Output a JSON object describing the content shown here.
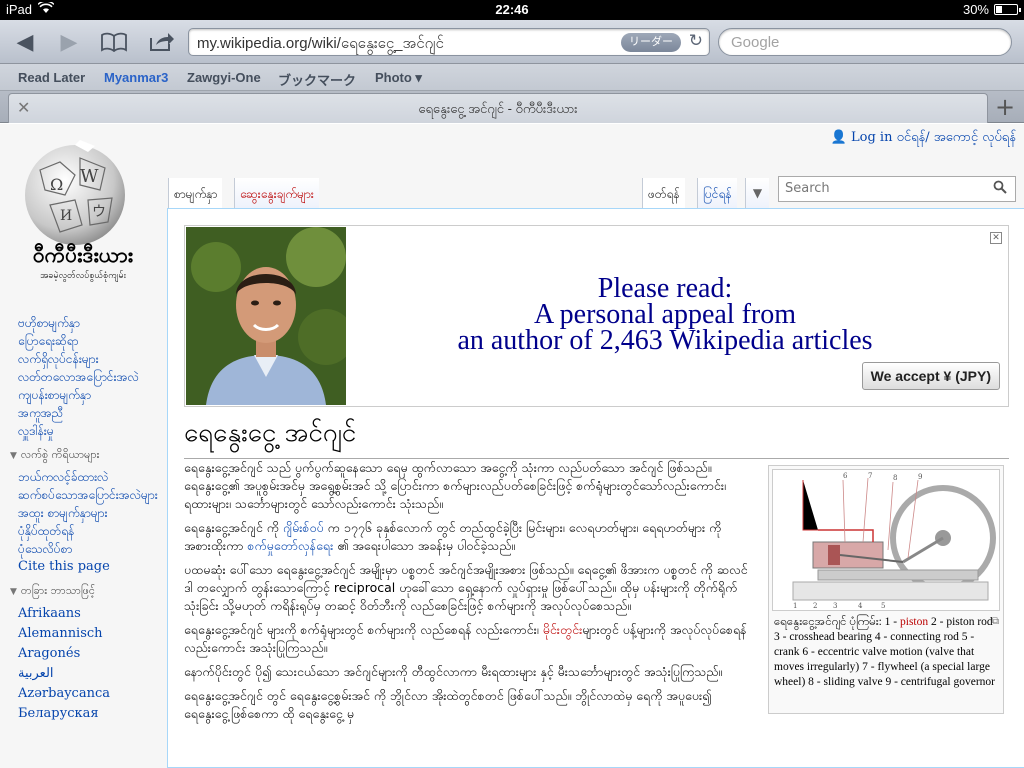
{
  "status": {
    "device": "iPad",
    "time": "22:46",
    "battery": "30%",
    "battery_level": 0.3
  },
  "toolbar": {
    "url": "my.wikipedia.org/wiki/ရေနွေးငွေ့_အင်ဂျင်",
    "reader_label": "リーダー",
    "search_placeholder": "Google"
  },
  "bookmarks": [
    "Read Later",
    "Myanmar3",
    "Zawgyi-One",
    "ブックマーク",
    "Photo ▾"
  ],
  "tab": {
    "title": "ရေနွေးငွေ့ အင်ဂျင် - ဝီကီပီးဒီးယား"
  },
  "wiki": {
    "login": "Log in ဝင်ရန်/ အကောင့် လုပ်ရန်",
    "logo_name": "ဝီကီပီးဒီးယား",
    "logo_tagline": "အခမဲ့လွတ်လပ်စွယ်စုံကျမ်း",
    "nav": [
      "ဗဟိုစာမျက်နှာ",
      "ပြောရေးဆိုရာ",
      "လက်ရှိလုပ်ငန်းများ",
      "လတ်တလောအပြောင်းအလဲ",
      "ကျပန်းစာမျက်နှာ",
      "အကူအညီ",
      "လှူဒါန်းမှု"
    ],
    "toolbox_heading": "လက်စွဲ ကိရိယာများ",
    "toolbox": [
      "ဘယ်ကလင့်ခ်ထားလဲ",
      "ဆက်စပ်သောအပြောင်းအလဲများ",
      "အထူး စာမျက်နှာများ",
      "ပုံနှိပ်ထုတ်ရန်",
      "ပုံသေလိပ်စာ",
      "Cite this page"
    ],
    "languages_heading": "တခြား ဘာသာဖြင့်",
    "languages": [
      "Afrikaans",
      "Alemannisch",
      "Aragonés",
      "العربية",
      "Azərbaycanca",
      "Беларуская"
    ],
    "tabs": {
      "page": "စာမျက်နှာ",
      "talk": "ဆွေးနွေးချက်များ",
      "read": "ဖတ်ရန်",
      "edit": "ပြင်ရန်"
    },
    "search_placeholder": "Search",
    "banner": {
      "line1": "Please read:",
      "line2": "A personal appeal from",
      "line3": "an author of 2,463 Wikipedia articles",
      "accept": "We accept ¥ (JPY)"
    },
    "article_title": "ရေနွေးငွေ့ အင်ဂျင်",
    "paragraphs": {
      "p1": "ရေနွေးငွေ့အင်ဂျင် သည် ပွက်ပွက်ဆူနေသော ရေမှ ထွက်လာသော အငွေ့ကို သုံးကာ လည်ပတ်သော အင်ဂျင် ဖြစ်သည်။ ရေနွေးငွေ့၏ အပူစွမ်းအင်မှ အရွေ့စွမ်းအင် သို့ ပြောင်းကာ စက်များလည်ပတ်စေခြင်းဖြင့် စက်ရုံများတွင်သော်လည်းကောင်း၊ ရထားများ၊ သင်္ဘောများတွင် သော်လည်းကောင်း သုံးသည်။",
      "p2a": "ရေနွေးငွေ့အင်ဂျင် ကို ",
      "p2_link1": "ဂျိမ်းစ်ဝပ်",
      "p2b": " က ၁၇၇၆ ခုနှစ်လောက် တွင် တည်ထွင်ခဲ့ပြီး မြင်းများ၊ လေရဟတ်များ၊ ရေရဟတ်များ ကို အစားထိုးကာ ",
      "p2_link2": "စက်မှုတော်လှန်ရေး",
      "p2c": " ၏ အရေးပါသော အခန်းမှ ပါဝင်ခဲ့သည်။",
      "p3": "ပထမဆုံး ပေါ်သော ရေနွေးငွေ့အင်ဂျင် အမျိုးမှာ ပစ္စတင် အင်ဂျင်အမျိုးအစား ဖြစ်သည်။ ရေငွေ့၏ ဖိအားက ပစ္စတင် ကို ဆလင်ဒါ တလျှောက် တွန်းသောကြောင့် reciprocal ဟုခေါ်သော ရှေ့နောက် လှုပ်ရှားမှု ဖြစ်ပေါ်သည်။ ထိုမှ ပန်းများကို တိုက်ရိုက်သုံးခြင်း သို့မဟုတ် ကရိန်းရုပ်မှ တဆင့် ဝိတ်ဘီးကို လည်စေခြင်းဖြင့် စက်များကို အလုပ်လုပ်စေသည်။",
      "p4a": "ရေနွေးငွေ့အင်ဂျင် များကို စက်ရုံများတွင် စက်များကို လည်စေရန် လည်းကောင်း၊ ",
      "p4_link": "မိုင်းတွင်း",
      "p4b": "များတွင် ပန့်များကို အလုပ်လုပ်စေရန် လည်းကောင်း အသုံးပြုကြသည်။",
      "p5": "နောက်ပိုင်းတွင် ပို၍ သေးငယ်သော အင်ဂျင်များကို တီထွင်လာကာ မီးရထားများ နှင့် မီးသင်္ဘောများတွင် အသုံးပြုကြသည်။",
      "p6": "ရေနွေးငွေ့အင်ဂျင် တွင် ရေနွေးငွေ့စွမ်းအင် ကို ဘွိုင်လာ အိုးထဲတွင်စတင် ဖြစ်ပေါ်သည်။ ဘွိုင်လာထဲမှ ရေကို အပူပေး၍ ရေနွေးငွေ့ဖြစ်စေကာ ထို ရေနွေးငွေ့ မှ"
    },
    "thumb_caption": {
      "a": "ရေနွေးငွေ့အင်ဂျင် ပုံကြမ်း: 1 - ",
      "link": "piston",
      "b": " 2 - piston rod 3 - crosshead bearing 4 - connecting rod 5 - crank 6 - eccentric valve motion (valve that moves irregularly) 7 - flywheel (a special large wheel) 8 - sliding valve 9 - centrifugal governor"
    },
    "diagram_numbers": [
      "1",
      "2",
      "3",
      "4",
      "5",
      "6",
      "7",
      "8",
      "9"
    ]
  }
}
